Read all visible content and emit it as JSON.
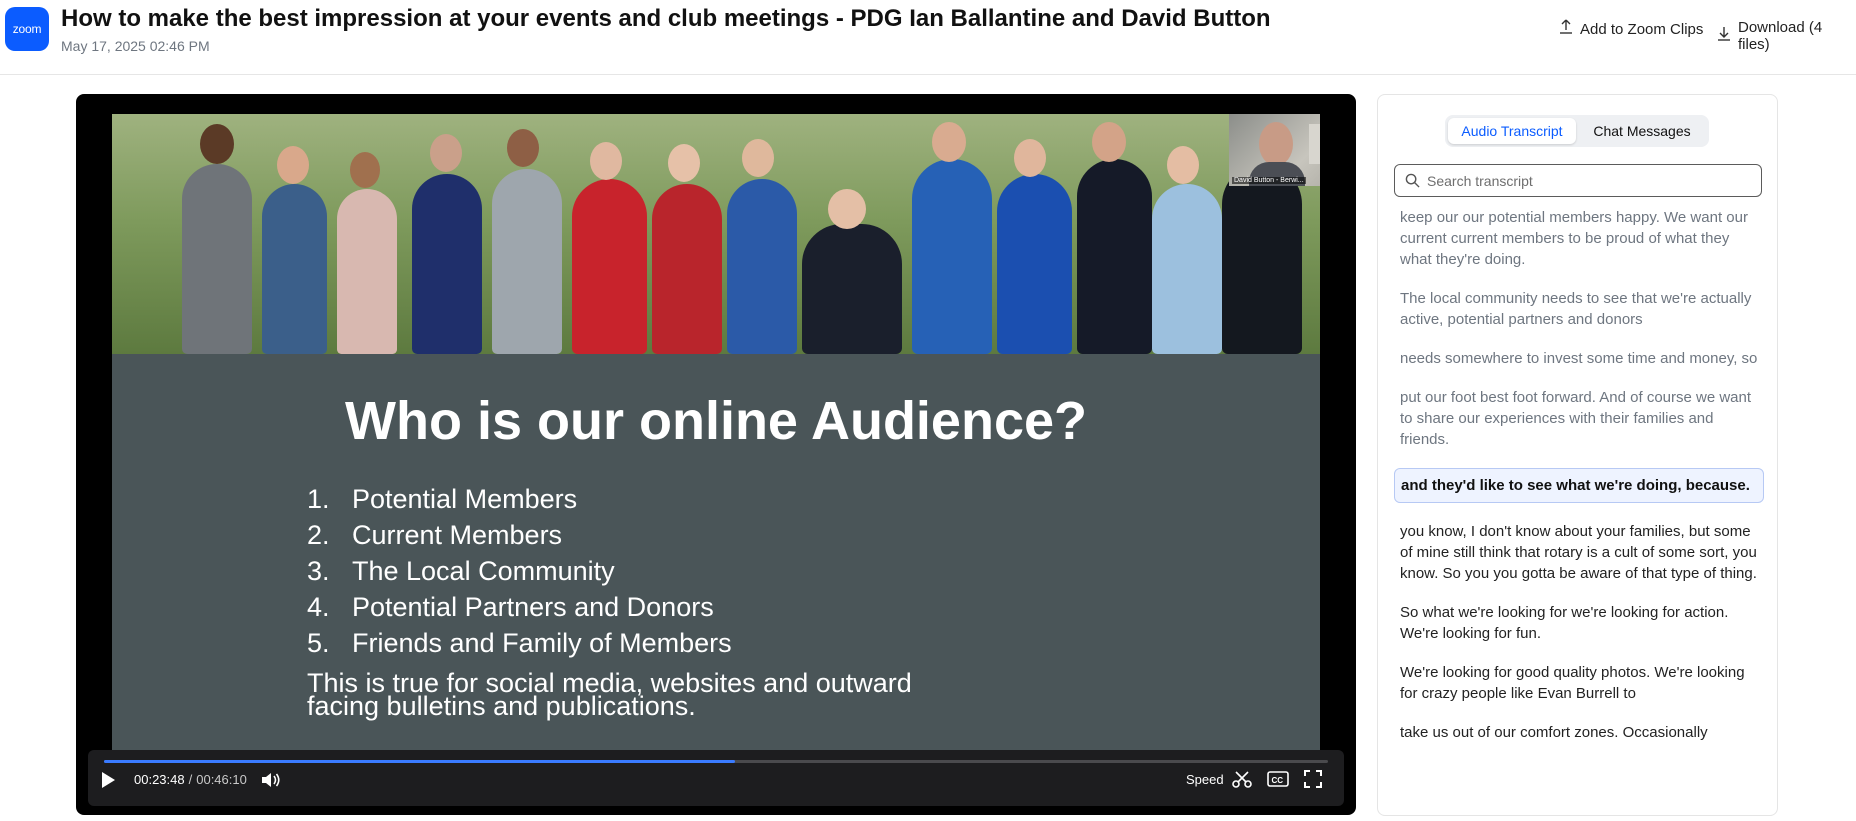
{
  "header": {
    "logo_text": "zoom",
    "title": "How to make the best impression at your events and club meetings - PDG Ian Ballantine and David Button",
    "date": "May 17, 2025 02:46 PM",
    "add_clips_label": "Add to Zoom Clips",
    "download_label": "Download (4 files)"
  },
  "slide": {
    "title": "Who is our online Audience?",
    "items": [
      {
        "num": "1.",
        "text": "Potential Members"
      },
      {
        "num": "2.",
        "text": "Current Members"
      },
      {
        "num": "3.",
        "text": "The Local Community"
      },
      {
        "num": "4.",
        "text": "Potential Partners and Donors"
      },
      {
        "num": "5.",
        "text": "Friends and Family of Members"
      }
    ],
    "note": "This is true for social media, websites and outward facing bulletins and publications.",
    "pip_label": "David Button - Berwi..."
  },
  "controls": {
    "current_time": "00:23:48",
    "separator": "/",
    "duration": "00:46:10",
    "progress_fraction": 0.5155,
    "speed_label": "Speed",
    "accent_color": "#3a7bff"
  },
  "panel": {
    "tabs": [
      {
        "label": "Audio Transcript",
        "active": true
      },
      {
        "label": "Chat Messages",
        "active": false
      }
    ],
    "search_placeholder": "Search transcript",
    "segments": [
      {
        "text": "keep our our potential members happy. We want our current current members to be proud of what they what they're doing.",
        "state": "past"
      },
      {
        "text": "The local community needs to see that we're actually active, potential partners and donors",
        "state": "past"
      },
      {
        "text": "needs somewhere to invest some time and money, so",
        "state": "past"
      },
      {
        "text": "put our foot best foot forward. And of course we want to share our experiences with their families and friends.",
        "state": "past"
      },
      {
        "text": "and they'd like to see what we're doing, because.",
        "state": "active"
      },
      {
        "text": "you know, I don't know about your families, but some of mine still think that rotary is a cult of some sort, you know. So you you gotta be aware of that type of thing.",
        "state": "future"
      },
      {
        "text": "So what we're looking for we're looking for action. We're looking for fun.",
        "state": "future"
      },
      {
        "text": "We're looking for good quality photos. We're looking for crazy people like Evan Burrell to",
        "state": "future"
      },
      {
        "text": "take us out of our comfort zones. Occasionally",
        "state": "future"
      }
    ]
  }
}
